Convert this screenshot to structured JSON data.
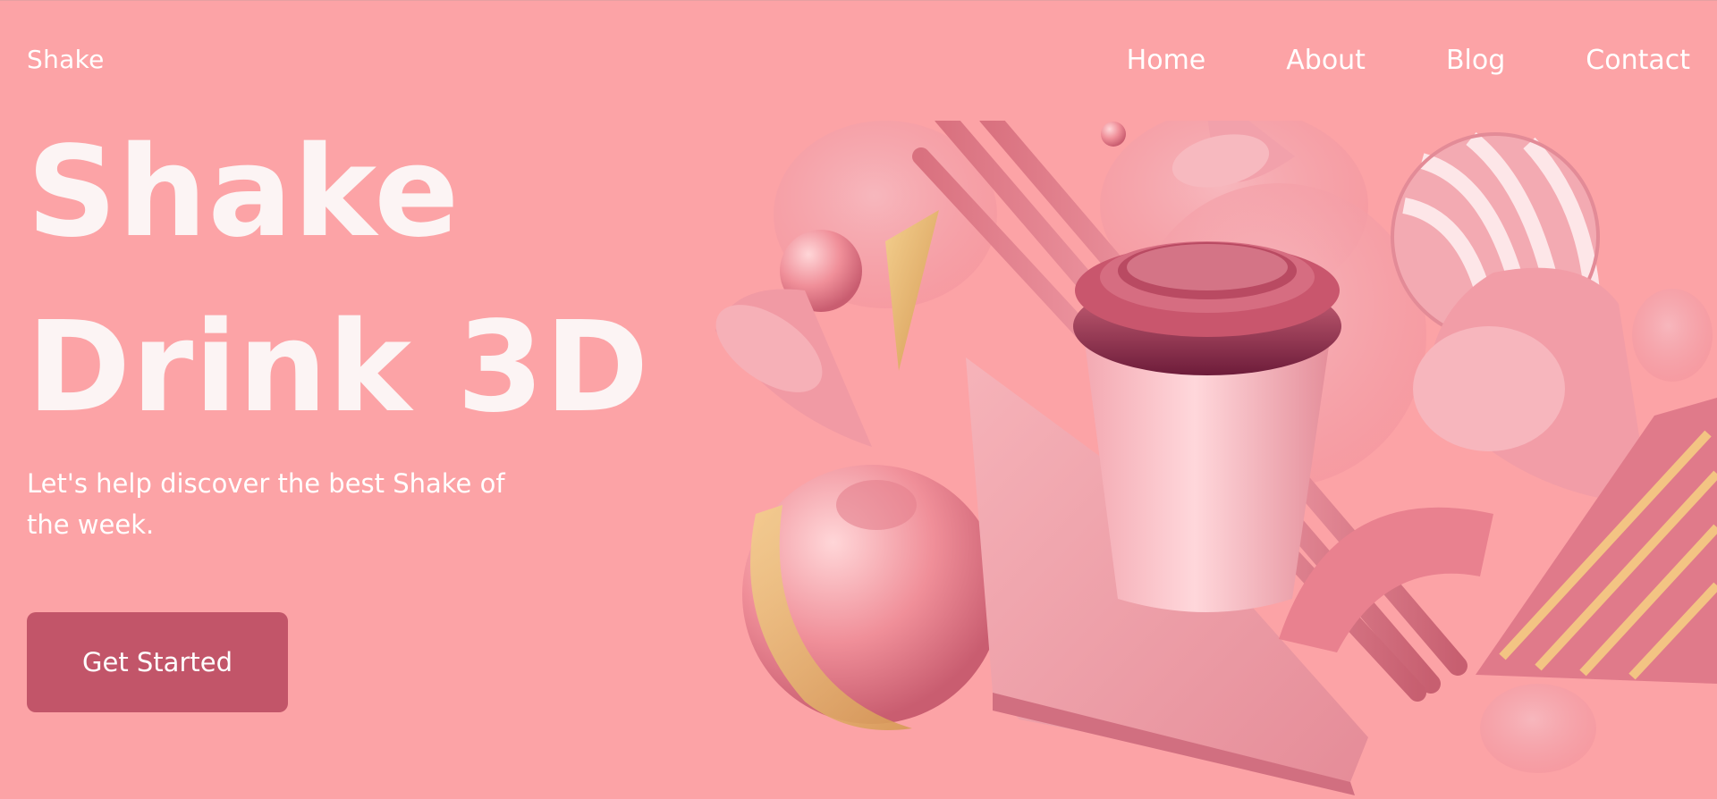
{
  "header": {
    "brand": "Shake",
    "nav": [
      "Home",
      "About",
      "Blog",
      "Contact"
    ]
  },
  "hero": {
    "title_line1": "Shake",
    "title_line2": "Drink 3D",
    "subtitle": "Let's help discover the best Shake of the week.",
    "cta_label": "Get Started"
  },
  "colors": {
    "background": "#fca3a6",
    "accent": "#c25569",
    "text": "#ffffff"
  }
}
